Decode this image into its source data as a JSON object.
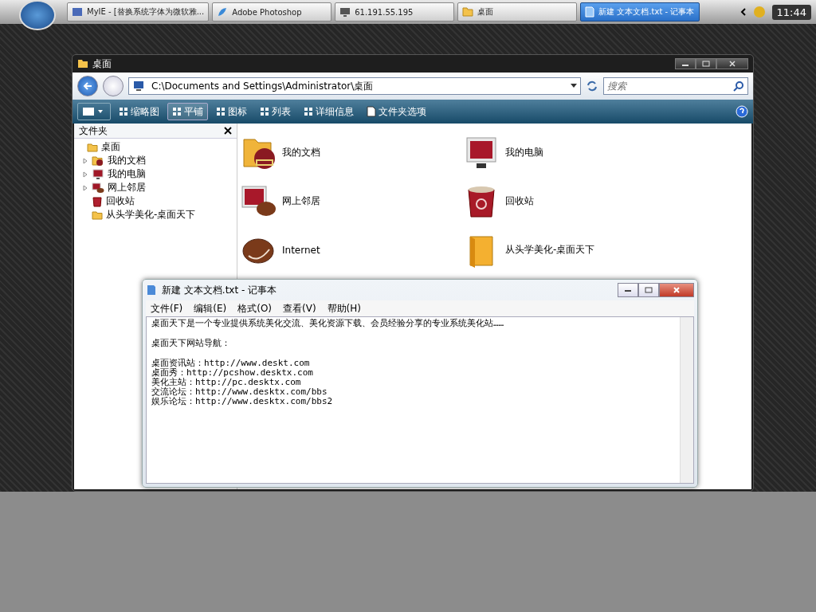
{
  "taskbar": {
    "items": [
      {
        "label": "MyIE - [替换系统字体为微软雅...",
        "kind": "browser",
        "selected": false
      },
      {
        "label": "Adobe Photoshop",
        "kind": "feather",
        "selected": false
      },
      {
        "label": "61.191.55.195",
        "kind": "remote",
        "selected": false
      },
      {
        "label": "桌面",
        "kind": "folder",
        "selected": false
      },
      {
        "label": "新建 文本文档.txt - 记事本",
        "kind": "notepad",
        "selected": true
      }
    ],
    "clock": "11:44"
  },
  "explorer": {
    "title": "桌面",
    "address": "C:\\Documents and Settings\\Administrator\\桌面",
    "search": {
      "placeholder": "搜索"
    },
    "toolbar": [
      {
        "label": "缩略图",
        "kind": "thumbs",
        "selected": false
      },
      {
        "label": "平铺",
        "kind": "tiles",
        "selected": true
      },
      {
        "label": "图标",
        "kind": "icons",
        "selected": false
      },
      {
        "label": "列表",
        "kind": "list",
        "selected": false
      },
      {
        "label": "详细信息",
        "kind": "details",
        "selected": false
      },
      {
        "label": "文件夹选项",
        "kind": "options",
        "selected": false
      }
    ],
    "folders_pane": {
      "title": "文件夹",
      "tree": [
        {
          "label": "桌面",
          "kind": "desktop",
          "has_children": false,
          "children": [
            {
              "label": "我的文档",
              "kind": "documents",
              "has_children": true
            },
            {
              "label": "我的电脑",
              "kind": "computer",
              "has_children": true
            },
            {
              "label": "网上邻居",
              "kind": "network",
              "has_children": true
            },
            {
              "label": "回收站",
              "kind": "recycle",
              "has_children": false
            },
            {
              "label": "从头学美化-桌面天下",
              "kind": "folder",
              "has_children": false
            }
          ]
        }
      ]
    },
    "items": [
      {
        "label": "我的文档",
        "kind": "documents"
      },
      {
        "label": "我的电脑",
        "kind": "computer"
      },
      {
        "label": "网上邻居",
        "kind": "network"
      },
      {
        "label": "回收站",
        "kind": "recycle"
      },
      {
        "label": "Internet",
        "kind": "internet"
      },
      {
        "label": "从头学美化-桌面天下",
        "kind": "folder"
      }
    ]
  },
  "notepad": {
    "title": "新建 文本文档.txt - 记事本",
    "menu": [
      "文件(F)",
      "编辑(E)",
      "格式(O)",
      "查看(V)",
      "帮助(H)"
    ],
    "paragraphs": [
      {
        "lines": [
          "桌面天下是一个专业提供系统美化交流、美化资源下载、会员经验分享的专业系统美化站……"
        ]
      },
      {
        "lines": [
          "桌面天下网站导航："
        ]
      },
      {
        "lines": [
          "桌面资讯站：http://www.deskt.com",
          "桌面秀：http://pcshow.desktx.com",
          "美化主站：http://pc.desktx.com",
          "交流论坛：http://www.desktx.com/bbs",
          "娱乐论坛：http://www.desktx.com/bbs2"
        ]
      }
    ]
  }
}
